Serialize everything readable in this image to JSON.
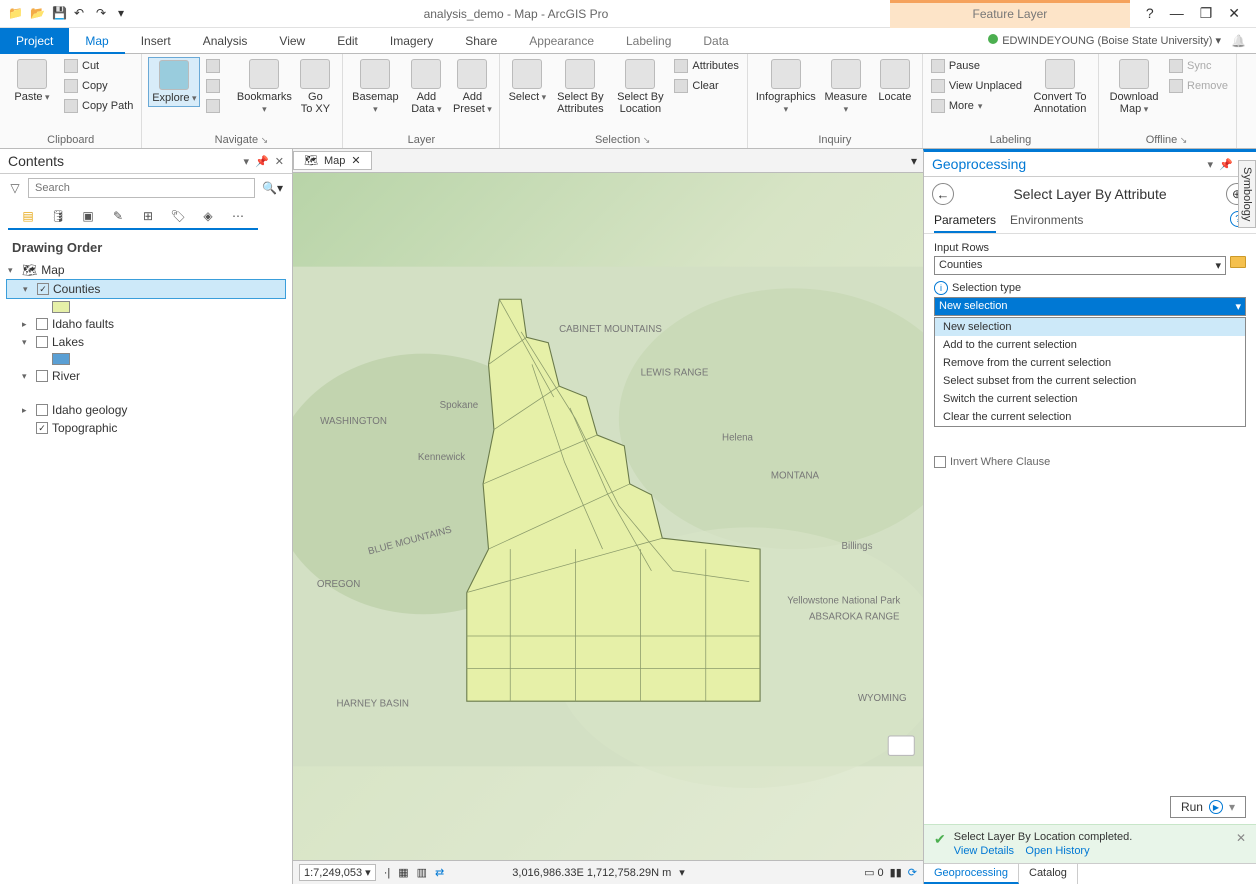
{
  "titlebar": {
    "app_title": "analysis_demo - Map - ArcGIS Pro",
    "contextual_tab": "Feature Layer",
    "help_icon": "?",
    "minimize_icon": "—",
    "restore_icon": "❐",
    "close_icon": "✕"
  },
  "user": {
    "name": "EDWINDEYOUNG (Boise State University)",
    "caret": "▾"
  },
  "ribbon_tabs": {
    "project": "Project",
    "map": "Map",
    "insert": "Insert",
    "analysis": "Analysis",
    "view": "View",
    "edit": "Edit",
    "imagery": "Imagery",
    "share": "Share",
    "appearance": "Appearance",
    "labeling": "Labeling",
    "data": "Data"
  },
  "ribbon": {
    "clipboard": {
      "label": "Clipboard",
      "paste": "Paste",
      "cut": "Cut",
      "copy": "Copy",
      "copy_path": "Copy Path"
    },
    "navigate": {
      "label": "Navigate",
      "explore": "Explore",
      "bookmarks": "Bookmarks",
      "goto_xy": "Go\nTo XY"
    },
    "layer": {
      "label": "Layer",
      "basemap": "Basemap",
      "add_data": "Add\nData",
      "add_preset": "Add\nPreset"
    },
    "selection": {
      "label": "Selection",
      "select": "Select",
      "select_by_attributes": "Select By\nAttributes",
      "select_by_location": "Select By\nLocation",
      "attributes": "Attributes",
      "clear": "Clear"
    },
    "inquiry": {
      "label": "Inquiry",
      "infographics": "Infographics",
      "measure": "Measure",
      "locate": "Locate"
    },
    "labeling": {
      "label": "Labeling",
      "pause": "Pause",
      "view_unplaced": "View Unplaced",
      "more": "More",
      "convert": "Convert To\nAnnotation"
    },
    "offline": {
      "label": "Offline",
      "download_map": "Download\nMap",
      "sync": "Sync",
      "remove": "Remove"
    }
  },
  "contents": {
    "title": "Contents",
    "search_placeholder": "Search",
    "drawing_order": "Drawing Order",
    "root": "Map",
    "items": {
      "counties": "Counties",
      "idaho_faults": "Idaho faults",
      "lakes": "Lakes",
      "river": "River",
      "idaho_geology": "Idaho geology",
      "topographic": "Topographic"
    },
    "swatches": {
      "counties": "#e6f0a8",
      "lakes": "#5a9fd4"
    }
  },
  "map_tab": {
    "label": "Map",
    "close": "✕"
  },
  "map_status": {
    "scale": "1:7,249,053",
    "coords": "3,016,986.33E 1,712,758.29N m",
    "sel_count": "0"
  },
  "geoprocessing": {
    "pane_title": "Geoprocessing",
    "tool_title": "Select Layer By Attribute",
    "tabs": {
      "parameters": "Parameters",
      "environments": "Environments"
    },
    "input_rows_label": "Input Rows",
    "input_rows_value": "Counties",
    "selection_type_label": "Selection type",
    "selection_type_value": "New selection",
    "options": [
      "New selection",
      "Add to the current selection",
      "Remove from the current selection",
      "Select subset from the current selection",
      "Switch the current selection",
      "Clear the current selection"
    ],
    "invert_label": "Invert Where Clause",
    "run": "Run",
    "status_msg": "Select Layer By Location completed.",
    "view_details": "View Details",
    "open_history": "Open History",
    "bottom_tabs": {
      "gp": "Geoprocessing",
      "catalog": "Catalog"
    }
  },
  "symbology_tab": "Symbology"
}
